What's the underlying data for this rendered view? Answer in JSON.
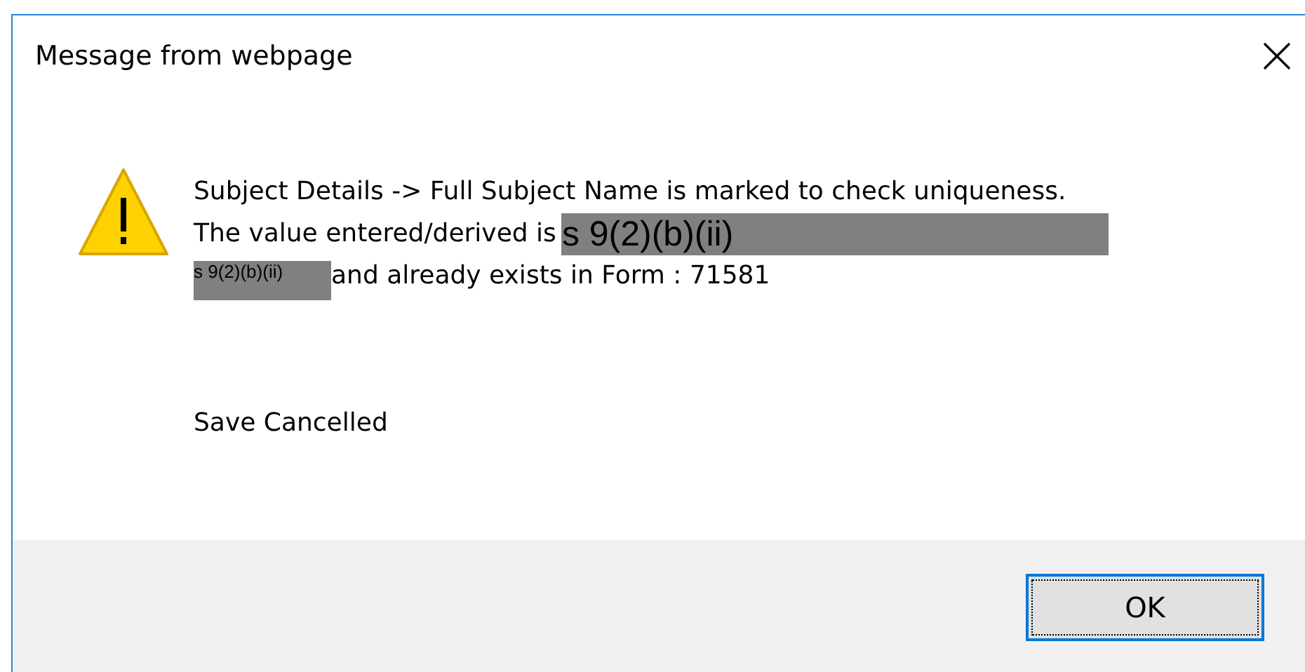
{
  "window": {
    "title": "Message from webpage"
  },
  "message": {
    "lines": [
      [
        {
          "kind": "text",
          "text": "Subject Details -> Full Subject Name is marked to check uniqueness."
        }
      ],
      [
        {
          "kind": "text",
          "text": "The value entered/derived is"
        },
        {
          "kind": "redaction",
          "text": "s 9(2)(b)(ii)"
        }
      ],
      [
        {
          "kind": "smallredaction",
          "text": "s 9(2)(b)(ii)"
        },
        {
          "kind": "text",
          "text": "and already exists in Form : 71581"
        }
      ]
    ],
    "status": "Save Cancelled"
  },
  "buttons": [
    {
      "label": "OK",
      "focused": true
    }
  ]
}
